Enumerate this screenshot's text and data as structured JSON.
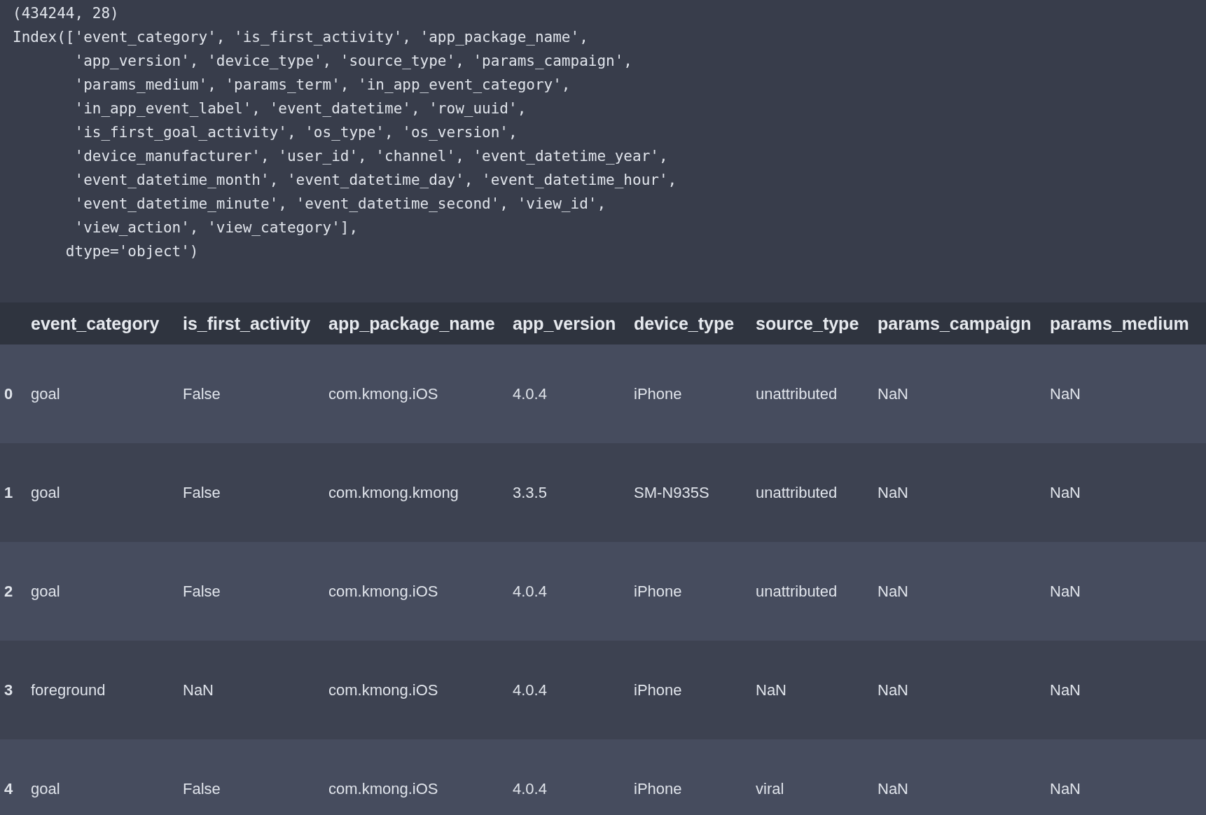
{
  "output": {
    "lines": [
      "(434244, 28)",
      "Index(['event_category', 'is_first_activity', 'app_package_name',",
      "       'app_version', 'device_type', 'source_type', 'params_campaign',",
      "       'params_medium', 'params_term', 'in_app_event_category',",
      "       'in_app_event_label', 'event_datetime', 'row_uuid',",
      "       'is_first_goal_activity', 'os_type', 'os_version',",
      "       'device_manufacturer', 'user_id', 'channel', 'event_datetime_year',",
      "       'event_datetime_month', 'event_datetime_day', 'event_datetime_hour',",
      "       'event_datetime_minute', 'event_datetime_second', 'view_id',",
      "       'view_action', 'view_category'],",
      "      dtype='object')"
    ]
  },
  "table": {
    "columns": [
      "event_category",
      "is_first_activity",
      "app_package_name",
      "app_version",
      "device_type",
      "source_type",
      "params_campaign",
      "params_medium"
    ],
    "rows": [
      {
        "index": "0",
        "cells": [
          "goal",
          "False",
          "com.kmong.iOS",
          "4.0.4",
          "iPhone",
          "unattributed",
          "NaN",
          "NaN"
        ]
      },
      {
        "index": "1",
        "cells": [
          "goal",
          "False",
          "com.kmong.kmong",
          "3.3.5",
          "SM-N935S",
          "unattributed",
          "NaN",
          "NaN"
        ]
      },
      {
        "index": "2",
        "cells": [
          "goal",
          "False",
          "com.kmong.iOS",
          "4.0.4",
          "iPhone",
          "unattributed",
          "NaN",
          "NaN"
        ]
      },
      {
        "index": "3",
        "cells": [
          "foreground",
          "NaN",
          "com.kmong.iOS",
          "4.0.4",
          "iPhone",
          "NaN",
          "NaN",
          "NaN"
        ]
      },
      {
        "index": "4",
        "cells": [
          "goal",
          "False",
          "com.kmong.iOS",
          "4.0.4",
          "iPhone",
          "viral",
          "NaN",
          "NaN"
        ]
      }
    ]
  }
}
